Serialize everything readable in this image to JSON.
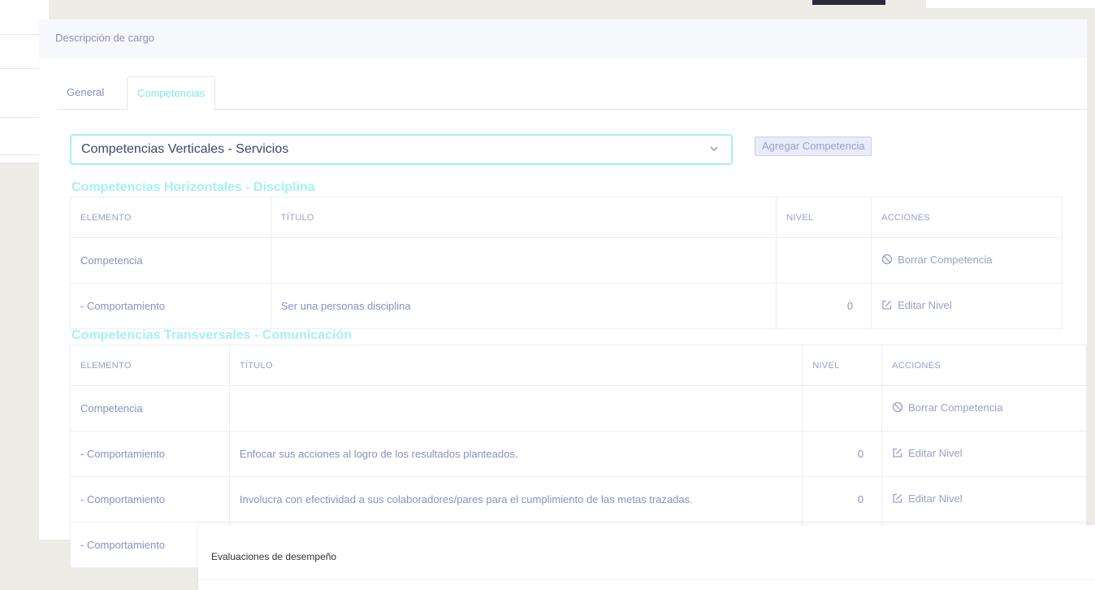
{
  "panel": {
    "title": "Descripción de cargo"
  },
  "tabs": [
    {
      "label": "General"
    },
    {
      "label": "Competencias"
    }
  ],
  "competency_select": {
    "value": "Competencias Verticales - Servicios"
  },
  "add_button": {
    "label": "Agregar Competencia"
  },
  "sections": [
    {
      "title": "Competencias Horizontales - Disciplina",
      "headers": [
        "ELEMENTO",
        "TÍTULO",
        "NIVEL",
        "ACCIONES"
      ],
      "rows": [
        {
          "elemento": "Competencia",
          "titulo": "",
          "nivel": "",
          "accion": "Borrar Competencia",
          "accion_icon": "block-icon"
        },
        {
          "elemento": "- Comportamiento",
          "titulo": "Ser una personas disciplina",
          "nivel": "0",
          "accion": "Editar Nivel",
          "accion_icon": "edit-icon"
        }
      ]
    },
    {
      "title": "Competencias Transversales - Comunicación",
      "headers": [
        "ELEMENTO",
        "TÍTULO",
        "NIVEL",
        "ACCIONES"
      ],
      "rows": [
        {
          "elemento": "Competencia",
          "titulo": "",
          "nivel": "",
          "accion": "Borrar Competencia",
          "accion_icon": "block-icon"
        },
        {
          "elemento": "- Comportamiento",
          "titulo": "Enfocar sus acciones al logro de los resultados planteados.",
          "nivel": "0",
          "accion": "Editar Nivel",
          "accion_icon": "edit-icon"
        },
        {
          "elemento": "- Comportamiento",
          "titulo": "Involucra con efectividad a sus colaboradores/pares para el cumplimiento de las metas trazadas.",
          "nivel": "0",
          "accion": "Editar Nivel",
          "accion_icon": "edit-icon"
        },
        {
          "elemento": "- Comportamiento",
          "titulo": "",
          "nivel": "",
          "accion": "",
          "accion_icon": ""
        }
      ]
    }
  ],
  "bottom_card": {
    "title": "Evaluaciones de desempeño"
  },
  "colors": {
    "accent": "#a6f0f4",
    "text": "#8a90c0",
    "dark_text": "#3f4572"
  }
}
